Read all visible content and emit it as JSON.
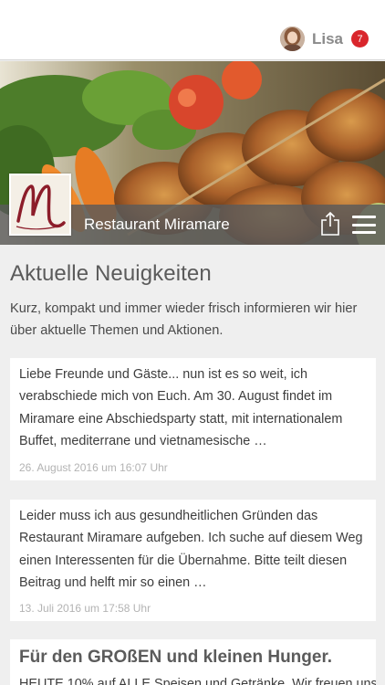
{
  "user": {
    "name": "Lisa",
    "notification_count": "7"
  },
  "restaurant": {
    "name": "Restaurant Miramare",
    "logo_letter": "M"
  },
  "page": {
    "title": "Aktuelle Neuigkeiten",
    "intro": "Kurz, kompakt und immer wieder frisch informieren wir hier über aktuelle Themen und Aktionen."
  },
  "news": [
    {
      "text": "Liebe Freunde und Gäste... nun ist es so weit, ich verabschiede mich von Euch. Am 30. August findet im Miramare eine Abschiedsparty statt, mit internationalem Buffet, mediterrane und vietnamesische …",
      "date": "26. August 2016 um 16:07 Uhr"
    },
    {
      "text": "Leider muss ich aus gesundheitlichen Gründen das Restaurant Miramare aufgeben. Ich suche auf diesem Weg einen Interessenten für die Übernahme. Bitte teilt diesen Beitrag und helft mir so einen …",
      "date": "13. Juli 2016 um 17:58 Uhr"
    },
    {
      "title": "Für den GROßEN und kleinen Hunger.",
      "text": "HEUTE 10% auf ALLE Speisen und Getränke. Wir freuen uns"
    }
  ],
  "colors": {
    "badge": "#d9262c",
    "background": "#efefef",
    "hero_bar": "#5a5a5a"
  },
  "icons": {
    "share": "share-icon",
    "menu": "hamburger-menu-icon"
  }
}
